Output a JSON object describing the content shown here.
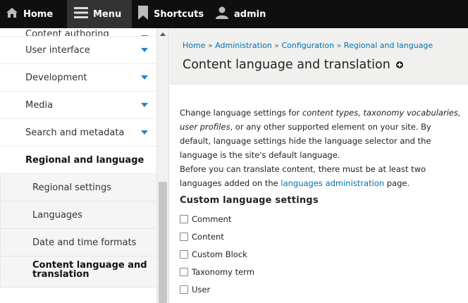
{
  "toolbar": {
    "home_label": "Home",
    "menu_label": "Menu",
    "shortcuts_label": "Shortcuts",
    "user_label": "admin"
  },
  "tray": {
    "items": [
      {
        "label": "Content authoring"
      },
      {
        "label": "User interface"
      },
      {
        "label": "Development"
      },
      {
        "label": "Media"
      },
      {
        "label": "Search and metadata"
      }
    ],
    "active_parent": "Regional and language",
    "sub_items": [
      {
        "label": "Regional settings"
      },
      {
        "label": "Languages"
      },
      {
        "label": "Date and time formats"
      },
      {
        "label": "Content language and translation"
      }
    ]
  },
  "breadcrumb": {
    "items": [
      "Home",
      "Administration",
      "Configuration",
      "Regional and language"
    ],
    "separator": "»"
  },
  "page_title": "Content language and translation",
  "description": {
    "p1_start": "Change language settings for ",
    "p1_em": "content types, taxonomy vocabularies, user profiles",
    "p1_end": ", or any other supported element on your site. By default, language settings hide the language selector and the language is the site's default language.",
    "p2_start": "Before you can translate content, there must be at least two languages added on the ",
    "p2_link": "languages administration",
    "p2_end": " page."
  },
  "section_title": "Custom language settings",
  "checkboxes": [
    "Comment",
    "Content",
    "Custom Block",
    "Taxonomy term",
    "User"
  ],
  "colors": {
    "toolbar_bg": "#0f0f0f",
    "link": "#0071b3",
    "caret": "#1e86c9"
  }
}
